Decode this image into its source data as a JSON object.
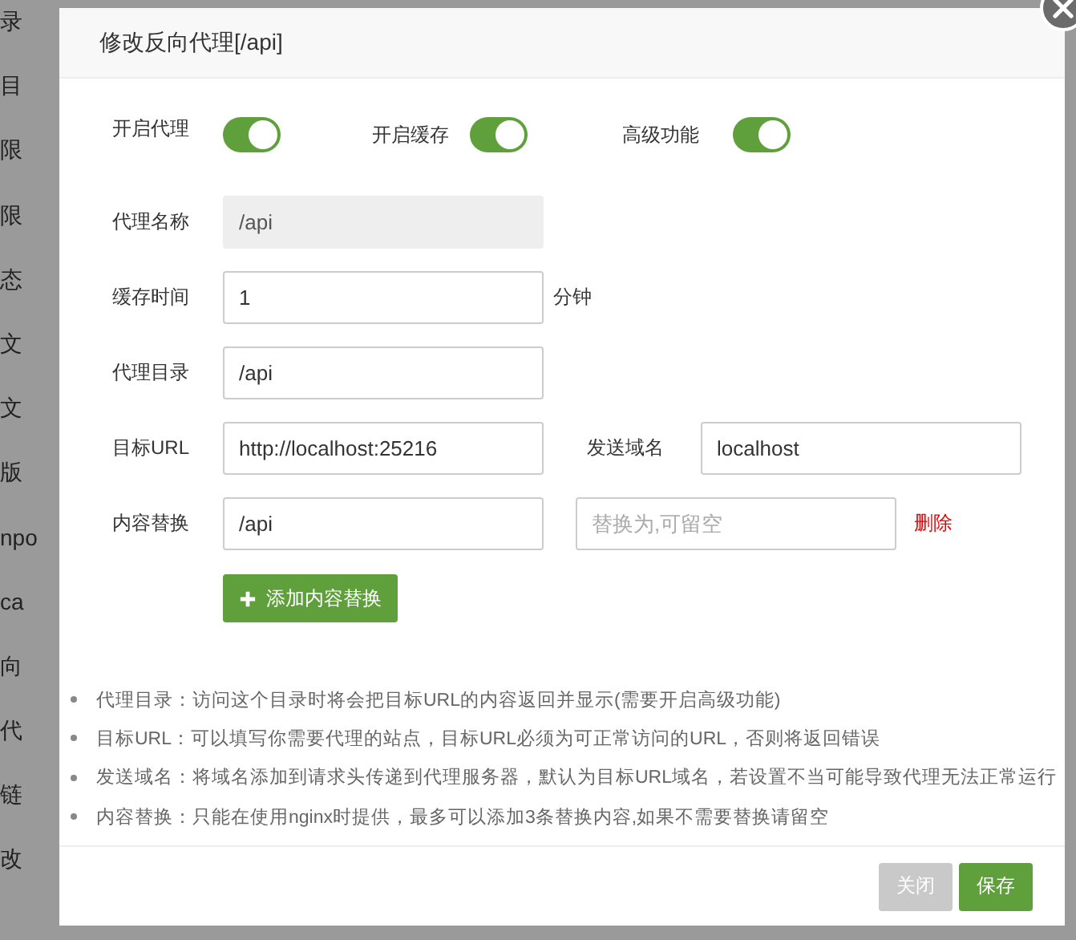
{
  "background": {
    "sidebar_items": [
      "录",
      "目",
      "限",
      "限",
      "态",
      "文",
      "文",
      "版",
      "npo",
      "ca",
      "向",
      "代",
      "链",
      "改"
    ]
  },
  "dialog": {
    "title": "修改反向代理[/api]",
    "switches": [
      {
        "label": "开启代理",
        "on": true
      },
      {
        "label": "开启缓存",
        "on": true
      },
      {
        "label": "高级功能",
        "on": true
      }
    ],
    "fields": [
      {
        "label": "代理名称",
        "value": "/api",
        "disabled": true
      },
      {
        "label": "缓存时间",
        "value": "1",
        "disabled": false,
        "unit": "分钟"
      },
      {
        "label": "代理目录",
        "value": "/api",
        "disabled": false
      },
      {
        "label": "目标URL",
        "value": "http://localhost:25216",
        "disabled": false,
        "extra": {
          "label": "发送域名",
          "value": "localhost"
        }
      },
      {
        "label": "内容替换",
        "value": "/api",
        "disabled": false,
        "extra": {
          "placeholder": "替换为,可留空"
        },
        "action": "删除"
      }
    ],
    "add_button": "添加内容替换",
    "notes": [
      "代理目录：访问这个目录时将会把目标URL的内容返回并显示(需要开启高级功能)",
      "目标URL：可以填写你需要代理的站点，目标URL必须为可正常访问的URL，否则将返回错误",
      "发送域名：将域名添加到请求头传递到代理服务器，默认为目标URL域名，若设置不当可能导致代理无法正常运行",
      "内容替换：只能在使用nginx时提供，最多可以添加3条替换内容,如果不需要替换请留空"
    ],
    "buttons": [
      {
        "label": "关闭",
        "kind": "cancel"
      },
      {
        "label": "保存",
        "kind": "primary"
      }
    ]
  }
}
